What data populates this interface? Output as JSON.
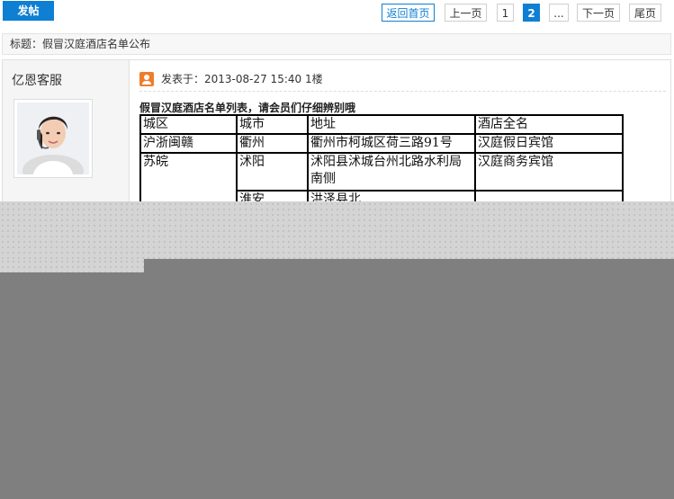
{
  "toolbar": {
    "post_label": "发帖",
    "pagination": {
      "home": "返回首页",
      "prev": "上一页",
      "pages": [
        "1",
        "2"
      ],
      "current": "2",
      "ellipsis": "...",
      "next": "下一页",
      "last": "尾页"
    }
  },
  "thread": {
    "title": "标题：假冒汉庭酒店名单公布"
  },
  "post": {
    "author": "亿恩客服",
    "meta": "发表于：2013-08-27 15:40   1楼",
    "intro": "假冒汉庭酒店名单列表，请会员们仔细辨别哦",
    "table": {
      "headers": [
        "城区",
        "城市",
        "地址",
        "酒店全名"
      ],
      "rows": [
        [
          "沪浙闽赣",
          "衢州",
          "衢州市柯城区荷三路91号",
          "汉庭假日宾馆"
        ],
        [
          "苏皖",
          "沭阳",
          "沭阳县沭城台州北路水利局南侧",
          "汉庭商务宾馆"
        ],
        [
          "",
          "淮安",
          "洪泽县北",
          ""
        ]
      ]
    }
  },
  "colors": {
    "accent": "#0e7fd3",
    "icon_orange": "#f07d2a",
    "overlay_dark": "#7f7f7f",
    "overlay_light": "#d4d4d4"
  }
}
